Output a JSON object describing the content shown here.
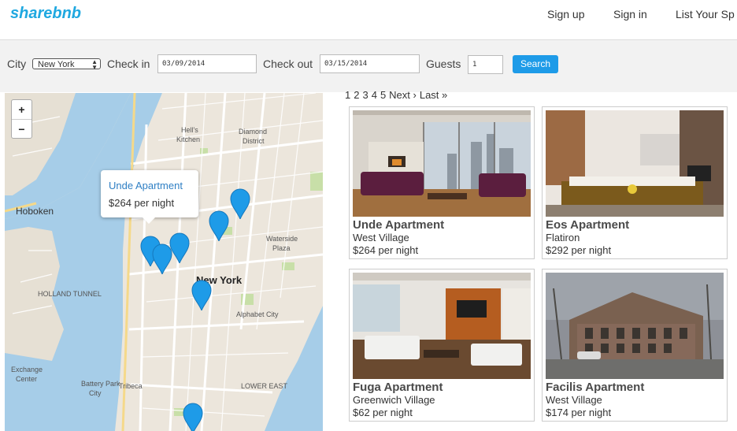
{
  "header": {
    "brand": "sharebnb",
    "nav": [
      {
        "label": "Sign up"
      },
      {
        "label": "Sign in"
      },
      {
        "label": "List Your Sp"
      }
    ]
  },
  "search": {
    "city_label": "City",
    "city_value": "New York",
    "checkin_label": "Check in",
    "checkin_value": "03/09/2014",
    "checkout_label": "Check out",
    "checkout_value": "03/15/2014",
    "guests_label": "Guests",
    "guests_value": "1",
    "search_button": "Search"
  },
  "map": {
    "zoom_in": "+",
    "zoom_out": "−",
    "labels": {
      "hoboken": "Hoboken",
      "new_york": "New York",
      "hells_kitchen_1": "Hell's",
      "hells_kitchen_2": "Kitchen",
      "diamond_1": "Diamond",
      "diamond_2": "District",
      "waterside_1": "Waterside",
      "waterside_2": "Plaza",
      "alphabet_city": "Alphabet City",
      "tribeca": "Tribeca",
      "battery_1": "Battery Park",
      "battery_2": "City",
      "exchange_1": "Exchange",
      "exchange_2": "Center",
      "lower_east": "LOWER EAST",
      "holland": "HOLLAND TUNNEL"
    },
    "popup": {
      "title": "Unde Apartment",
      "price": "$264 per night"
    }
  },
  "pagination": {
    "pages": [
      "1",
      "2",
      "3",
      "4",
      "5"
    ],
    "next": "Next ›",
    "last": "Last »"
  },
  "listings": [
    {
      "title": "Unde Apartment",
      "neighborhood": "West Village",
      "price": "$264 per night"
    },
    {
      "title": "Eos Apartment",
      "neighborhood": "Flatiron",
      "price": "$292 per night"
    },
    {
      "title": "Fuga Apartment",
      "neighborhood": "Greenwich Village",
      "price": "$62 per night"
    },
    {
      "title": "Facilis Apartment",
      "neighborhood": "West Village",
      "price": "$174 per night"
    }
  ],
  "colors": {
    "brand": "#1fa8e0",
    "button": "#1e9be8",
    "marker": "#1e9be8",
    "water": "#a6cde8"
  }
}
